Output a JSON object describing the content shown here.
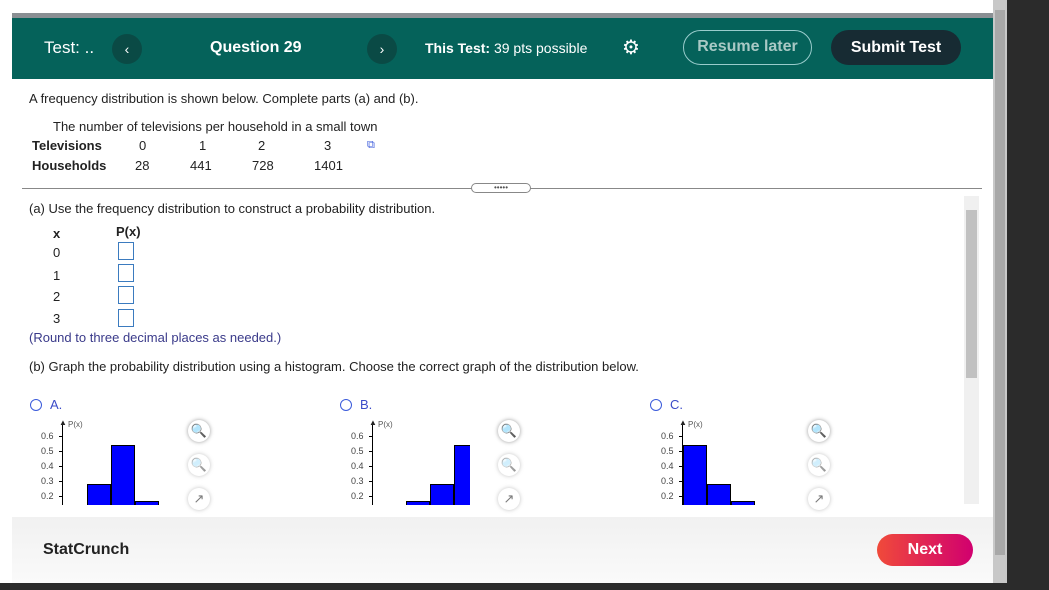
{
  "header": {
    "test_label": "Test: ..",
    "prev": "‹",
    "question": "Question 29",
    "next": "›",
    "this_test_bold": "This Test:",
    "this_test_rest": " 39 pts possible",
    "resume": "Resume later",
    "submit": "Submit Test"
  },
  "problem": {
    "intro": "A frequency distribution is shown below. Complete parts (a) and (b).",
    "table_title": "The number of televisions per household in a small town",
    "row1_label": "Televisions",
    "row1": [
      "0",
      "1",
      "2",
      "3"
    ],
    "row2_label": "Households",
    "row2": [
      "28",
      "441",
      "728",
      "1401"
    ]
  },
  "part_a": {
    "text": "(a) Use the frequency distribution to construct a probability distribution.",
    "col_x": "x",
    "col_p": "P(x)",
    "xs": [
      "0",
      "1",
      "2",
      "3"
    ],
    "note": "(Round to three decimal places as needed.)"
  },
  "part_b": {
    "text": "(b) Graph the probability distribution using a histogram. Choose the correct graph of the distribution below."
  },
  "chart_data": [
    {
      "type": "bar",
      "option": "A.",
      "ylabel": "P(x)",
      "yticks": [
        "0.6",
        "0.5",
        "0.4",
        "0.3",
        "0.2"
      ],
      "values": [
        0.011,
        0.28,
        0.539,
        0.17
      ],
      "color": "#0000ff"
    },
    {
      "type": "bar",
      "option": "B.",
      "ylabel": "P(x)",
      "yticks": [
        "0.6",
        "0.5",
        "0.4",
        "0.3",
        "0.2"
      ],
      "values": [
        0.011,
        0.17,
        0.28,
        0.539
      ],
      "color": "#0000ff"
    },
    {
      "type": "bar",
      "option": "C.",
      "ylabel": "P(x)",
      "yticks": [
        "0.6",
        "0.5",
        "0.4",
        "0.3",
        "0.2"
      ],
      "values": [
        0.539,
        0.28,
        0.17,
        0.011
      ],
      "color": "#0000ff"
    }
  ],
  "footer": {
    "statcrunch": "StatCrunch",
    "next": "Next"
  },
  "colors": {
    "header": "#05625a",
    "next_button": "#e6265a",
    "bars": "#0000ff"
  }
}
